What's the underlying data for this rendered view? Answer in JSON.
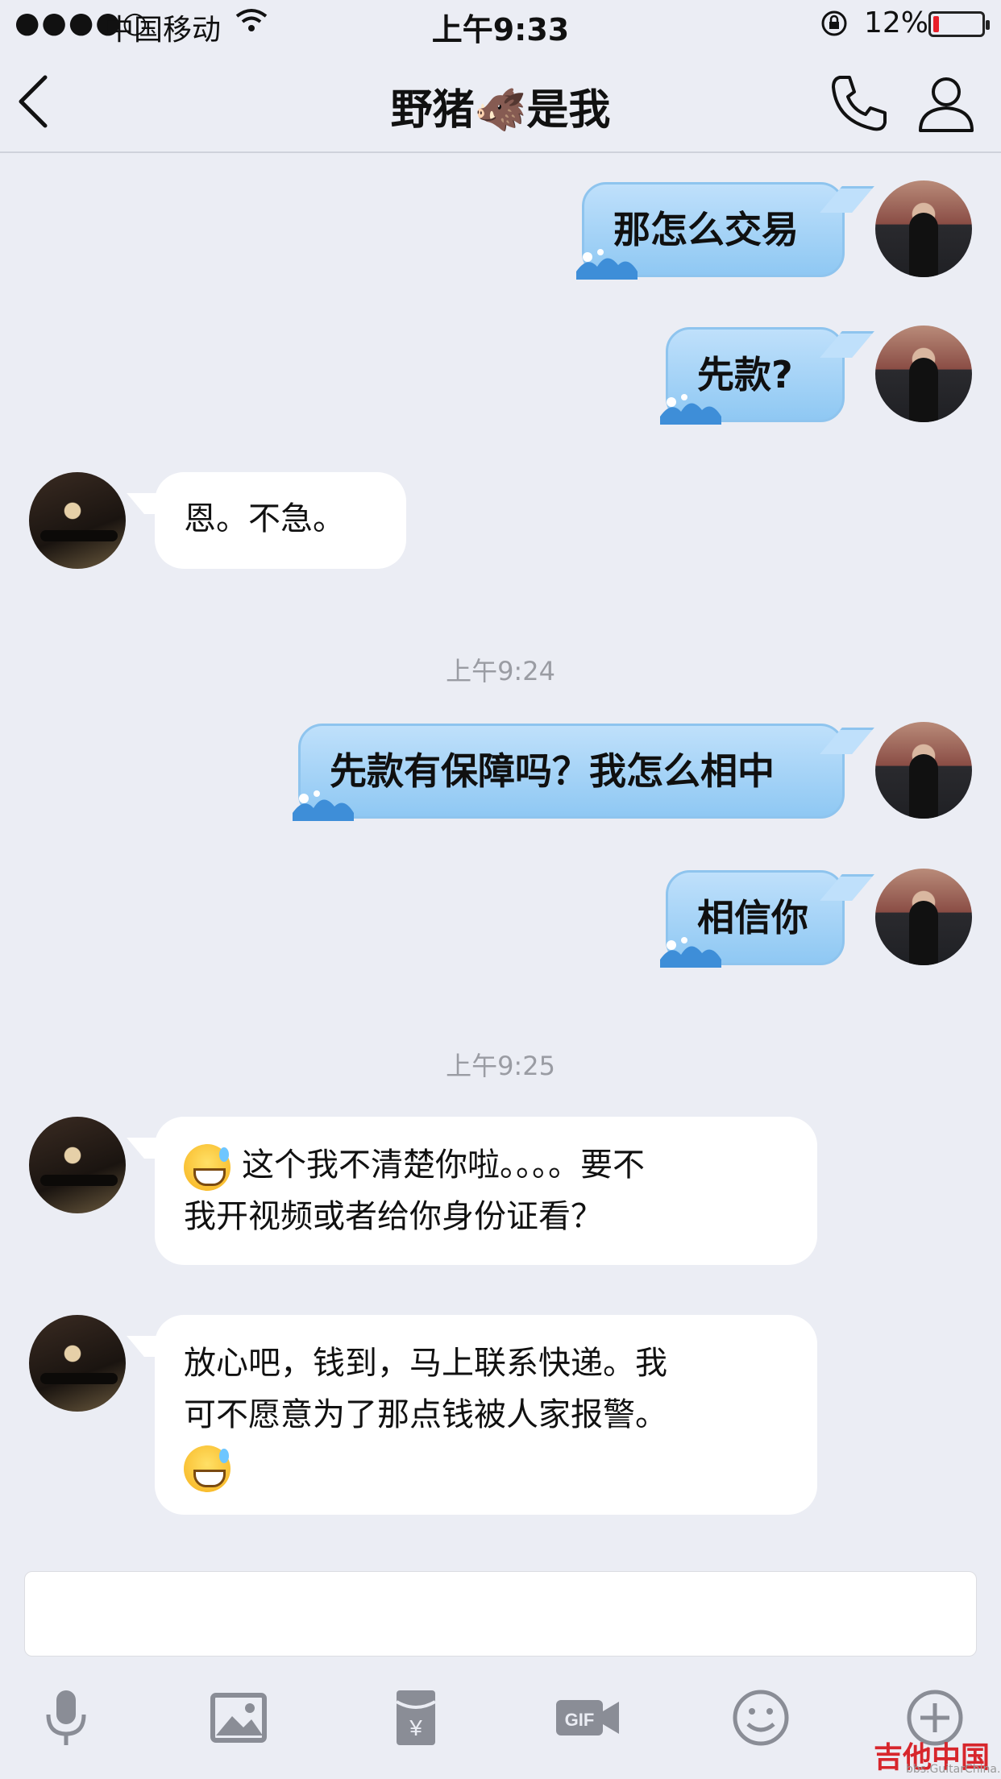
{
  "status_bar": {
    "signal": "●●●●○",
    "carrier": "中国移动",
    "time": "上午9:33",
    "battery_percent": "12%",
    "battery_level": 0.12,
    "battery_color": "#e8202a"
  },
  "nav": {
    "title": "野猪🐗是我",
    "icons": [
      "back-chevron-icon",
      "phone-icon",
      "profile-icon"
    ]
  },
  "messages": [
    {
      "side": "me",
      "text": "那怎么交易"
    },
    {
      "side": "me",
      "text": "先款?"
    },
    {
      "side": "them",
      "text": "恩。不急。"
    },
    {
      "timestamp": "上午9:24"
    },
    {
      "side": "me",
      "text": "先款有保障吗？我怎么相中"
    },
    {
      "side": "me",
      "text": "相信你"
    },
    {
      "timestamp": "上午9:25"
    },
    {
      "side": "them",
      "line1": "这个我不清楚你啦。。。。要不",
      "line2": "我开视频或者给你身份证看？",
      "emoji": "sweat-smile"
    },
    {
      "side": "them",
      "line1": "放心吧，钱到，马上联系快递。我",
      "line2": "可不愿意为了那点钱被人家报警。",
      "emoji": "sweat-smile"
    }
  ],
  "toolbar": {
    "icons": [
      "microphone-icon",
      "image-icon",
      "red-packet-icon",
      "gif-icon",
      "emoji-icon",
      "plus-icon"
    ]
  },
  "watermark": {
    "name": "吉他中国",
    "url": "bbs.GuitarChina.com"
  },
  "colors": {
    "background": "#ebedf4",
    "my_bubble": "#a8d4f7",
    "their_bubble": "#ffffff",
    "timestamp": "#9a9ca3"
  }
}
